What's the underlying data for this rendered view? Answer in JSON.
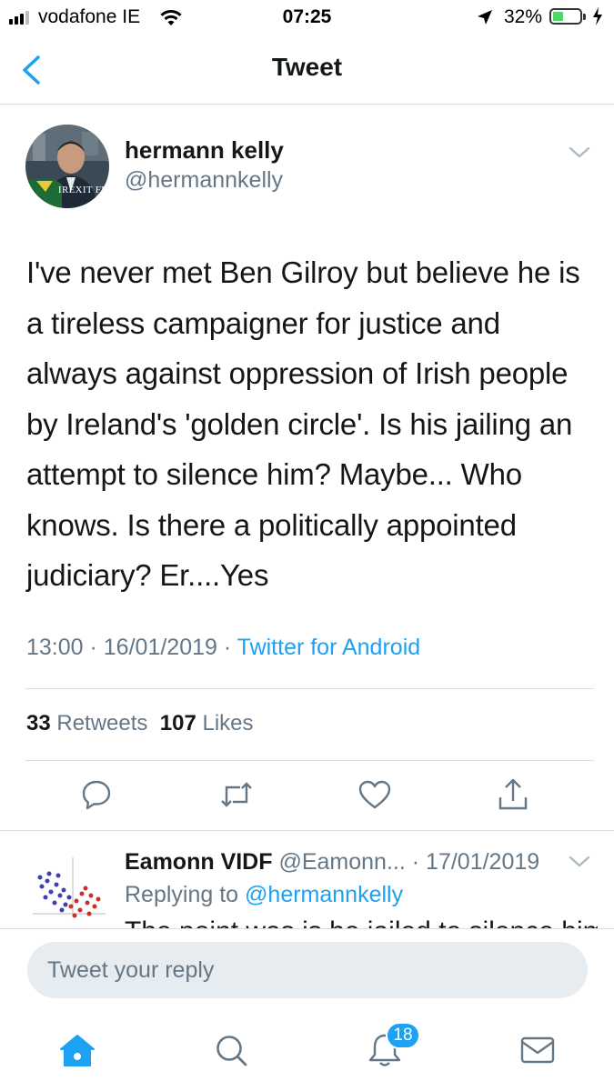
{
  "status_bar": {
    "carrier": "vodafone IE",
    "time": "07:25",
    "battery_percent": "32%",
    "battery_level": 0.32
  },
  "nav": {
    "title": "Tweet"
  },
  "tweet": {
    "author_name": "hermann kelly",
    "author_handle": "@hermannkelly",
    "avatar_badge_text": "IREXIT FREEDOM",
    "text": "I've never met Ben Gilroy but believe he is a tireless campaigner for justice and always against oppression of Irish people by Ireland's 'golden circle'. Is his jailing an attempt to silence him? Maybe... Who knows. Is there a politically appointed judiciary? Er....Yes",
    "time": "13:00",
    "date": "16/01/2019",
    "separator": " · ",
    "source": "Twitter for Android",
    "retweets_count": "33",
    "retweets_label": "Retweets",
    "likes_count": "107",
    "likes_label": "Likes"
  },
  "reply": {
    "author_name": "Eamonn VIDF",
    "author_handle": "@Eamonn...",
    "date": "· 17/01/2019",
    "replying_prefix": "Replying to",
    "replying_handle": "@hermannkelly",
    "text_partial": "The point was is he jailed to silence him"
  },
  "compose": {
    "placeholder": "Tweet your reply"
  },
  "tab_bar": {
    "notifications_badge": "18"
  },
  "colors": {
    "accent": "#1da1f2",
    "muted": "#657786",
    "divider": "#d9dee2",
    "compose_bg": "#e6ecf0"
  }
}
